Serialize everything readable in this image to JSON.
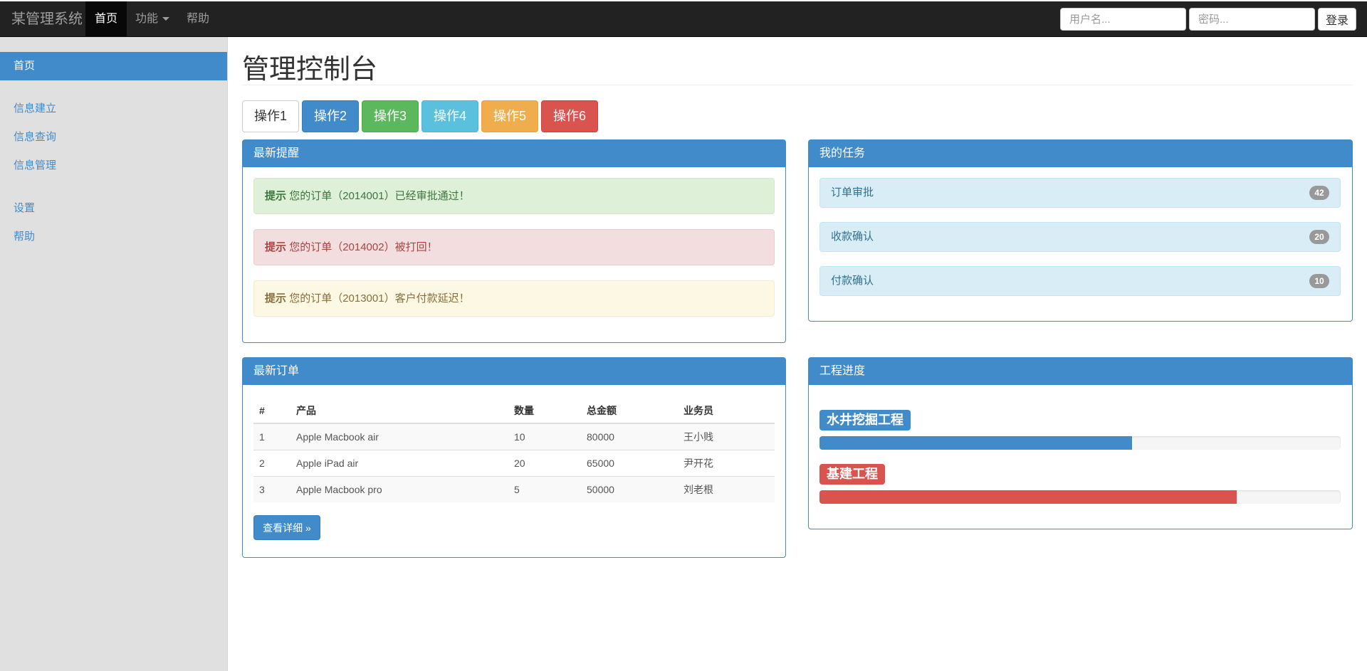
{
  "navbar": {
    "brand": "某管理系统",
    "items": [
      {
        "label": "首页",
        "active": true
      },
      {
        "label": "功能",
        "dropdown": true
      },
      {
        "label": "帮助"
      }
    ],
    "username_placeholder": "用户名...",
    "password_placeholder": "密码...",
    "login_label": "登录"
  },
  "sidebar": {
    "items": [
      {
        "label": "首页",
        "active": true
      },
      {
        "label": "信息建立"
      },
      {
        "label": "信息查询"
      },
      {
        "label": "信息管理"
      },
      {
        "label": "设置"
      },
      {
        "label": "帮助"
      }
    ]
  },
  "main": {
    "title": "管理控制台",
    "buttons": [
      {
        "label": "操作1",
        "style": "default",
        "color": "#ffffff"
      },
      {
        "label": "操作2",
        "style": "primary",
        "color": "#428bca"
      },
      {
        "label": "操作3",
        "style": "success",
        "color": "#5cb85c"
      },
      {
        "label": "操作4",
        "style": "info",
        "color": "#5bc0de"
      },
      {
        "label": "操作5",
        "style": "warning",
        "color": "#f0ad4e"
      },
      {
        "label": "操作6",
        "style": "danger",
        "color": "#d9534f"
      }
    ]
  },
  "reminders": {
    "title": "最新提醒",
    "alerts": [
      {
        "strong": "提示",
        "text": "您的订单（2014001）已经审批通过！",
        "type": "success"
      },
      {
        "strong": "提示",
        "text": "您的订单（2014002）被打回！",
        "type": "danger"
      },
      {
        "strong": "提示",
        "text": "您的订单（2013001）客户付款延迟！",
        "type": "warning"
      }
    ]
  },
  "tasks": {
    "title": "我的任务",
    "items": [
      {
        "label": "订单审批",
        "count": "42"
      },
      {
        "label": "收款确认",
        "count": "20"
      },
      {
        "label": "付款确认",
        "count": "10"
      }
    ]
  },
  "orders": {
    "title": "最新订单",
    "columns": [
      "#",
      "产品",
      "数量",
      "总金额",
      "业务员"
    ],
    "rows": [
      [
        "1",
        "Apple Macbook air",
        "10",
        "80000",
        "王小贱"
      ],
      [
        "2",
        "Apple iPad air",
        "20",
        "65000",
        "尹开花"
      ],
      [
        "3",
        "Apple Macbook pro",
        "5",
        "50000",
        "刘老根"
      ]
    ],
    "detail_label": "查看详细 »"
  },
  "progress": {
    "title": "工程进度",
    "items": [
      {
        "label": "水井挖掘工程",
        "percent": 60,
        "color": "#428bca"
      },
      {
        "label": "基建工程",
        "percent": 80,
        "color": "#d9534f"
      }
    ]
  }
}
